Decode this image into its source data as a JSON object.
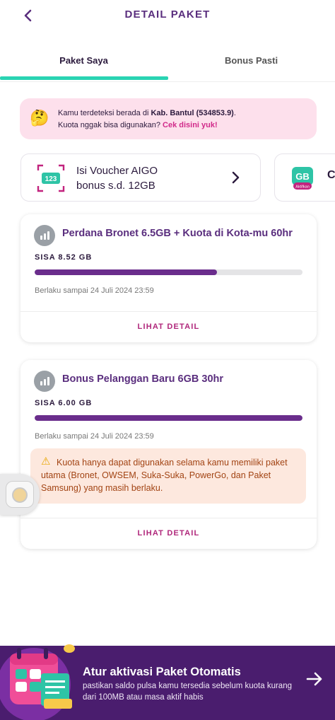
{
  "header": {
    "title": "DETAIL PAKET",
    "back_icon": "chevron-left-icon"
  },
  "tabs": [
    {
      "label": "Paket Saya",
      "active": true
    },
    {
      "label": "Bonus Pasti",
      "active": false
    }
  ],
  "location_notice": {
    "line1_prefix": "Kamu terdeteksi berada di ",
    "location": "Kab. Bantul (534853.9)",
    "line1_suffix": ".",
    "line2_prefix": "Kuota nggak bisa digunakan? ",
    "link": "Cek disini yuk!",
    "icon": "thinking-face-emoji"
  },
  "voucher": {
    "line1": "Isi Voucher AIGO",
    "line2": "bonus s.d. 12GB",
    "icon": "voucher-123-icon"
  },
  "promo_card": {
    "badge_text": "GB",
    "badge_sub": "Aktifkan",
    "label_partial": "C"
  },
  "packages": [
    {
      "name": "Perdana Bronet 6.5GB + Kuota di Kota-mu 60hr",
      "remaining": "SISA 8.52 GB",
      "progress_fraction": 0.68,
      "expiry": "Berlaku sampai 24 Juli 2024 23:59",
      "action": "LIHAT DETAIL"
    },
    {
      "name": "Bonus Pelanggan Baru 6GB 30hr",
      "remaining": "SISA 6.00 GB",
      "progress_fraction": 1.0,
      "expiry": "Berlaku sampai 24 Juli 2024 23:59",
      "warning": "Kuota hanya dapat digunakan selama kamu memiliki paket utama (Bronet, OWSEM, Suka-Suka, PowerGo, dan Paket Samsung) yang masih berlaku.",
      "action": "LIHAT DETAIL"
    }
  ],
  "auto_banner": {
    "title": "Atur aktivasi Paket Otomatis",
    "subtitle": "pastikan saldo pulsa kamu tersedia sebelum kuota kurang dari 100MB atau masa aktif habis",
    "icon": "calendar-icon"
  },
  "colors": {
    "brand_purple": "#5a2e7e",
    "progress_fill": "#6a2d8c",
    "tab_indicator": "#2ad4b3",
    "link_pink": "#d12a8a",
    "banner_bg": "#4a1d6e"
  }
}
